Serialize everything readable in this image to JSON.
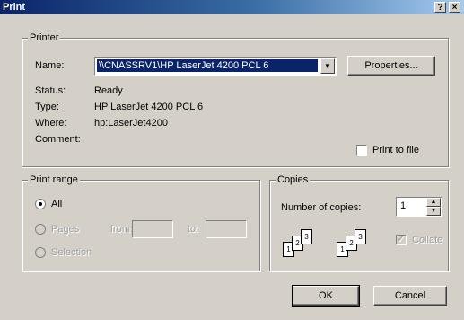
{
  "window": {
    "title": "Print",
    "help_glyph": "?",
    "close_glyph": "×"
  },
  "printer": {
    "group_label": "Printer",
    "name_label": "Name:",
    "name_value": "\\\\CNASSRV1\\HP LaserJet 4200 PCL 6",
    "properties_label": "Properties...",
    "status_label": "Status:",
    "status_value": "Ready",
    "type_label": "Type:",
    "type_value": "HP LaserJet 4200 PCL 6",
    "where_label": "Where:",
    "where_value": "hp:LaserJet4200",
    "comment_label": "Comment:",
    "comment_value": "",
    "print_to_file_label": "Print to file",
    "print_to_file_checked": false
  },
  "print_range": {
    "group_label": "Print range",
    "all_label": "All",
    "all_selected": true,
    "pages_label": "Pages",
    "from_label": "from:",
    "from_value": "",
    "to_label": "to:",
    "to_value": "",
    "selection_label": "Selection"
  },
  "copies": {
    "group_label": "Copies",
    "number_label": "Number of copies:",
    "number_value": "1",
    "collate_label": "Collate",
    "collate_checked": true,
    "collate_icon_pages": [
      "1",
      "2",
      "3"
    ]
  },
  "buttons": {
    "ok_label": "OK",
    "cancel_label": "Cancel"
  }
}
